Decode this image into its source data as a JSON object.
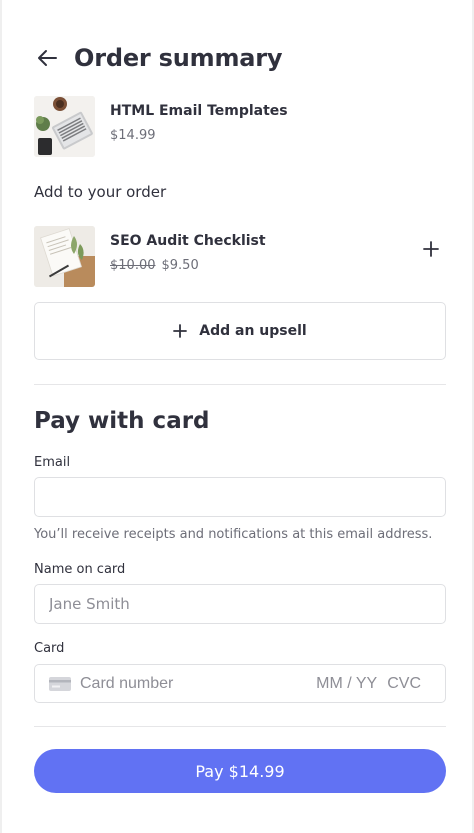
{
  "header": {
    "title": "Order summary",
    "back_icon": "arrow-left-icon"
  },
  "product": {
    "name": "HTML Email Templates",
    "price": "$14.99"
  },
  "add_to_order": {
    "heading": "Add to your order",
    "item": {
      "name": "SEO Audit Checklist",
      "original_price": "$10.00",
      "sale_price": "$9.50",
      "add_icon": "plus-icon"
    },
    "upsell_button": {
      "label": "Add an upsell",
      "icon": "plus-icon"
    }
  },
  "payment": {
    "heading": "Pay with card",
    "email": {
      "label": "Email",
      "value": "",
      "placeholder": "",
      "helper": "You’ll receive receipts and notifications at this email address."
    },
    "name_on_card": {
      "label": "Name on card",
      "value": "",
      "placeholder": "Jane Smith"
    },
    "card": {
      "label": "Card",
      "number_placeholder": "Card number",
      "expiry_placeholder": "MM / YY",
      "cvc_placeholder": "CVC",
      "icon": "credit-card-icon"
    },
    "pay_button": "Pay $14.99"
  },
  "colors": {
    "accent": "#6172f3",
    "text": "#30313d",
    "muted": "#6d6e78",
    "border": "#dfe0e3"
  }
}
